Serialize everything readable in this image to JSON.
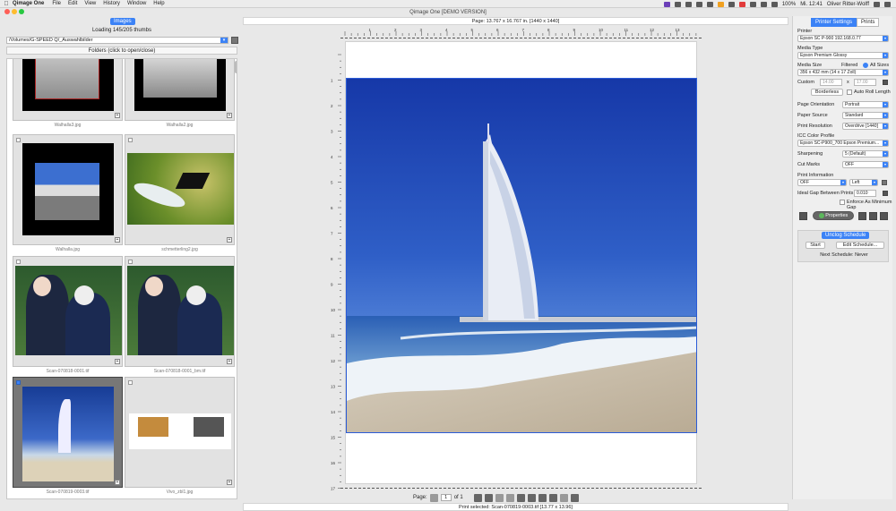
{
  "menubar": {
    "app_name": "Qimage One",
    "items": [
      "File",
      "Edit",
      "View",
      "History",
      "Window",
      "Help"
    ],
    "battery": "100%",
    "time": "Mi. 12:41",
    "user": "Oliver Ritter-Wolff"
  },
  "window": {
    "title": "Qimage One [DEMO VERSION]"
  },
  "left": {
    "images_button": "Images",
    "loading_text": "Loading 145/205 thumbs",
    "path": "/Volumes/G-SPEED Q/_Auswahlbilder",
    "folders_label": "Folders (click to open/close)",
    "thumbs": [
      {
        "name": "Walhalla3.jpg",
        "checked": false
      },
      {
        "name": "Walhalla2.jpg",
        "checked": false
      },
      {
        "name": "Walhalla.jpg",
        "checked": false
      },
      {
        "name": "schmetterling2.jpg",
        "checked": false
      },
      {
        "name": "Scan-070818-0001.tif",
        "checked": false
      },
      {
        "name": "Scan-070818-0001_bm.tif",
        "checked": false
      },
      {
        "name": "Scan-070819-0003.tif",
        "checked": true
      },
      {
        "name": "Vivo_zbl1.jpg",
        "checked": false
      }
    ]
  },
  "center": {
    "page_info": "Page: 13.767 x 16.767 in. [1440 x 1440]",
    "ruler_top": [
      "1",
      "2",
      "3",
      "4",
      "5",
      "6",
      "7",
      "8",
      "9",
      "10",
      "11",
      "12",
      "13",
      "14"
    ],
    "ruler_left": [
      "1",
      "2",
      "3",
      "4",
      "5",
      "6",
      "7",
      "8",
      "9",
      "10",
      "11",
      "12",
      "13",
      "14",
      "15",
      "16",
      "17"
    ],
    "page_label": "Page:",
    "page_num": "1",
    "page_of": "of 1",
    "print_selected": "Print selected: Scan-070819-0003.tif [13.77 x 13.96]"
  },
  "right": {
    "tabs": [
      "Printer Settings",
      "Prints"
    ],
    "printer_label": "Printer",
    "printer_value": "Epson SC P-900 192.168.0.77",
    "media_type_label": "Media Type",
    "media_type_value": "Epson Premium Glossy",
    "media_size_label": "Media Size",
    "filtered_label": "Filtered",
    "all_sizes_label": "All Sizes",
    "media_size_value": "356 x 432 mm (14 x 17 Zoll)",
    "custom_label": "Custom",
    "custom_w": "14.00",
    "custom_x": "x",
    "custom_h": "17.00",
    "borderless_button": "Borderless",
    "auto_roll_label": "Auto Roll Length",
    "orientation_label": "Page Orientation",
    "orientation_value": "Portrait",
    "paper_source_label": "Paper Source",
    "paper_source_value": "Standard",
    "resolution_label": "Print Resolution",
    "resolution_value": "Overdrive [1440]",
    "icc_label": "ICC Color Profile",
    "icc_value": "Epson SC-P900_700 Epson Premium...",
    "sharpening_label": "Sharpening",
    "sharpening_value": "5 (Default)",
    "cutmarks_label": "Cut Marks",
    "cutmarks_value": "OFF",
    "print_info_label": "Print Information",
    "print_info_value": "OFF",
    "print_info_pos": "Left",
    "gap_label": "Ideal Gap Between Prints",
    "gap_value": "0.010",
    "enforce_label": "Enforce As Minimum Gap",
    "properties_button": "Properties",
    "unclog_button": "Unclog Schedule",
    "start_button": "Start",
    "edit_schedule_button": "Edit Schedule...",
    "next_schedule": "Next Schedule: Never"
  },
  "colors": {
    "accent": "#3b82f6",
    "photo_border": "#2a5bd7"
  }
}
